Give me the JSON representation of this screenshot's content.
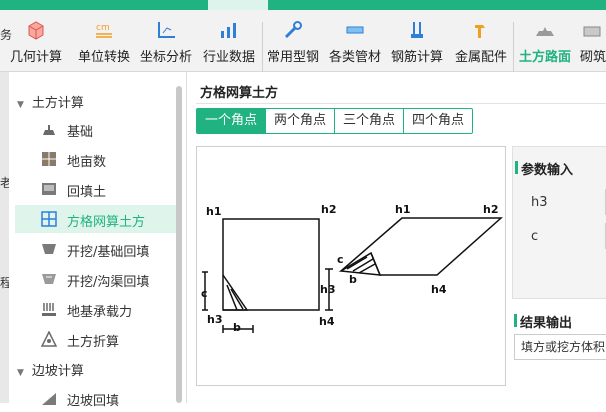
{
  "toolbar": {
    "items": [
      {
        "label": "几何计算",
        "icon": "cube-icon"
      },
      {
        "label": "单位转换",
        "icon": "unit-cm-icon"
      },
      {
        "label": "坐标分析",
        "icon": "axis-icon"
      },
      {
        "label": "行业数据",
        "icon": "chart-icon"
      },
      {
        "label": "常用型钢",
        "icon": "wrench-icon"
      },
      {
        "label": "各类管材",
        "icon": "pipe-icon"
      },
      {
        "label": "钢筋计算",
        "icon": "rebar-icon"
      },
      {
        "label": "金属配件",
        "icon": "hammer-icon"
      },
      {
        "label": "土方路面",
        "icon": "road-icon"
      },
      {
        "label": "砌筑",
        "icon": "brick-icon"
      }
    ],
    "active_index": 8
  },
  "left_strip": {
    "chars": [
      "务",
      "老",
      "程"
    ]
  },
  "sidebar": {
    "group1": "土方计算",
    "items": [
      {
        "label": "基础"
      },
      {
        "label": "地亩数"
      },
      {
        "label": "回填土"
      },
      {
        "label": "方格网算土方"
      },
      {
        "label": "开挖/基础回填"
      },
      {
        "label": "开挖/沟渠回填"
      },
      {
        "label": "地基承载力"
      },
      {
        "label": "土方折算"
      }
    ],
    "selected_index": 3,
    "group2": "边坡计算",
    "group2_items": [
      {
        "label": "边坡回填"
      }
    ]
  },
  "main": {
    "title": "方格网算土方",
    "tabs": [
      "一个角点",
      "两个角点",
      "三个角点",
      "四个角点"
    ],
    "selected_tab": 0
  },
  "figure": {
    "labels": {
      "h1": "h1",
      "h2": "h2",
      "h3": "h3",
      "h4": "h4",
      "b": "b",
      "c": "c"
    }
  },
  "params": {
    "header": "参数输入",
    "fields": [
      {
        "label": "h3"
      },
      {
        "label": "c"
      }
    ]
  },
  "results": {
    "header": "结果输出",
    "output_text": "填方或挖方体积"
  },
  "colors": {
    "accent": "#20b281"
  }
}
